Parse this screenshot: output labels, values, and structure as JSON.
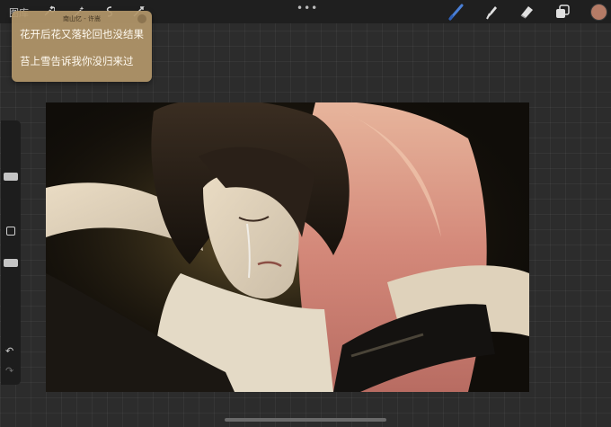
{
  "topbar": {
    "gallery_label": "图库",
    "dots": "•••"
  },
  "notification": {
    "header": "南山忆 - 许嵩",
    "lines": [
      "花开后花又落轮回也没结果",
      "苔上雪告诉我你没归来过"
    ]
  },
  "tools": {
    "color": "#b57b66",
    "active_color": "#4a7fd6"
  },
  "sidebar": {
    "undo": "↶",
    "redo": "↷"
  }
}
